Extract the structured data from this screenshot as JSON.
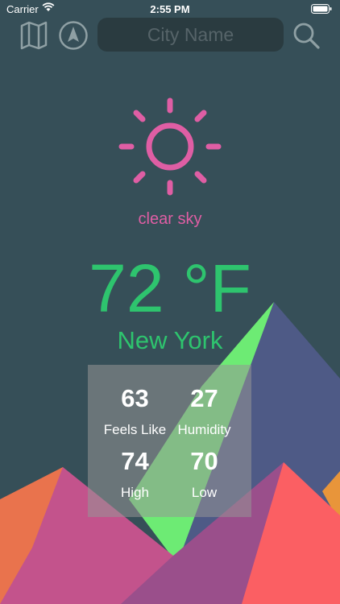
{
  "status_bar": {
    "carrier": "Carrier",
    "time": "2:55 PM"
  },
  "toolbar": {
    "map_icon": "map-icon",
    "location_icon": "navigation-arrow-icon",
    "search_icon": "magnifying-glass-icon",
    "city_placeholder": "City Name",
    "city_value": ""
  },
  "weather": {
    "icon": "sun-icon",
    "condition": "clear sky",
    "temperature": "72 °F",
    "city": "New York",
    "stats": {
      "feels_like_value": "63",
      "feels_like_label": "Feels Like",
      "humidity_value": "27",
      "humidity_label": "Humidity",
      "high_value": "74",
      "high_label": "High",
      "low_value": "70",
      "low_label": "Low"
    }
  },
  "colors": {
    "background": "#364f58",
    "accent_pink": "#df5ea4",
    "accent_green": "#2ec46e",
    "icon_gray": "#8fa0a4"
  }
}
